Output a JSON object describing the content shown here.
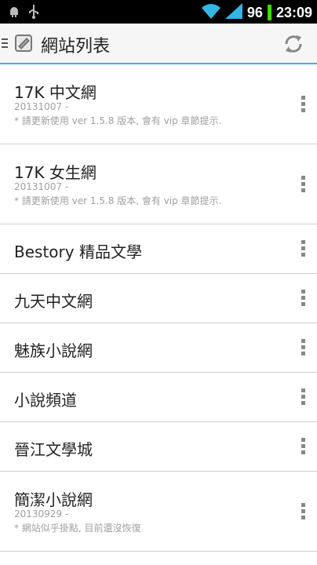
{
  "status_bar": {
    "left_icons": [
      "android-debug-icon",
      "usb-icon"
    ],
    "right_icons": [
      "wifi-icon",
      "signal-icon"
    ],
    "battery": "96",
    "time": "23:09"
  },
  "action_bar": {
    "title": "網站列表",
    "refresh_icon": "refresh-icon",
    "accent_color": "#33b5e5"
  },
  "sites": [
    {
      "title": "17K 中文網",
      "date": "20131007 -",
      "note": "* 請更新使用 ver 1.5.8 版本, 會有 vip 章節提示."
    },
    {
      "title": "17K 女生網",
      "date": "20131007 -",
      "note": "* 請更新使用 ver 1.5.8 版本, 會有 vip 章節提示."
    },
    {
      "title": "Bestory 精品文學"
    },
    {
      "title": "九天中文網"
    },
    {
      "title": "魅族小說網"
    },
    {
      "title": "小說頻道"
    },
    {
      "title": "晉江文學城"
    },
    {
      "title": "簡潔小說網",
      "date": "20130929 -",
      "note": "* 網站似乎掛點, 目前還沒恢復"
    }
  ]
}
